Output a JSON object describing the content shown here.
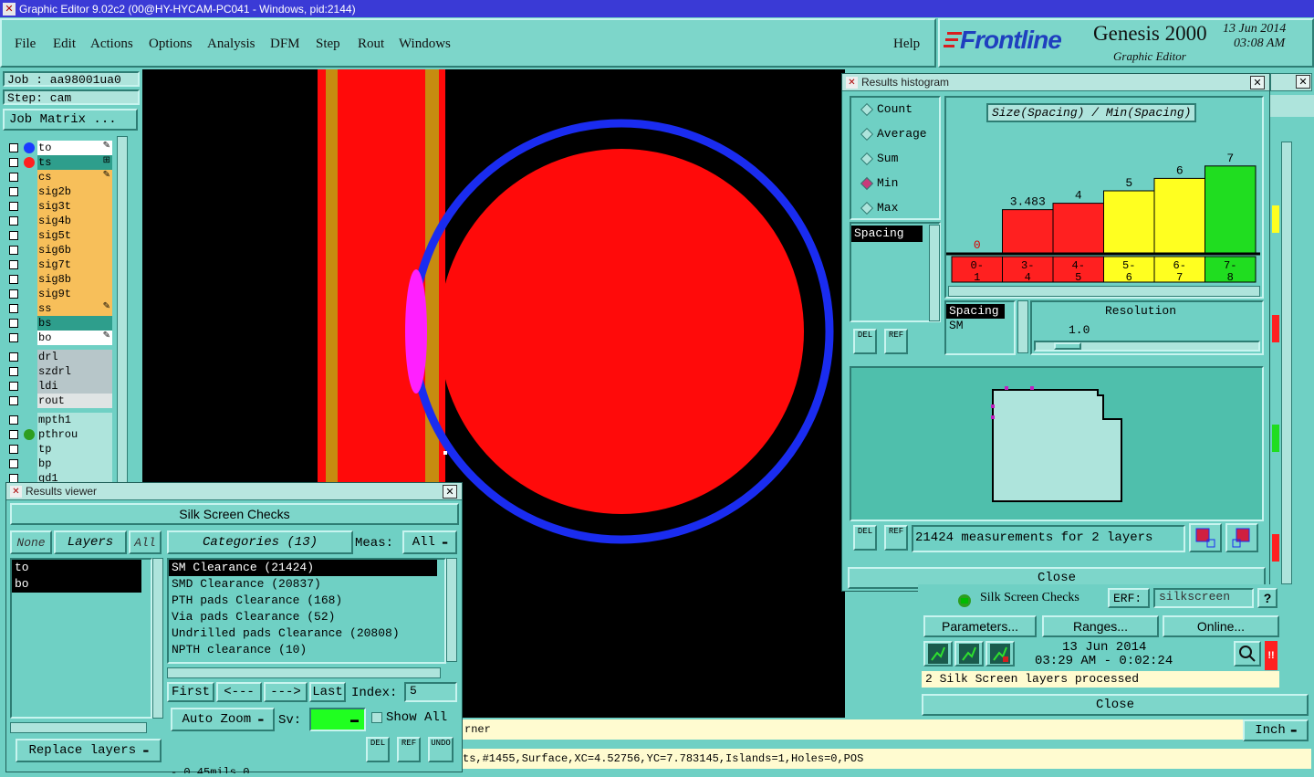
{
  "window_title": "Graphic Editor 9.02c2 (00@HY-HYCAM-PC041 - Windows, pid:2144)",
  "menu": [
    "File",
    "Edit",
    "Actions",
    "Options",
    "Analysis",
    "DFM",
    "Step",
    "Rout",
    "Windows"
  ],
  "help_label": "Help",
  "logo": {
    "brand": "Frontline",
    "product": "Genesis 2000",
    "subtitle": "Graphic Editor",
    "date": "13 Jun 2014",
    "time": "03:08 AM"
  },
  "job": {
    "job_line": "Job : aa98001ua0",
    "step_line": "Step: cam",
    "matrix_button": "Job Matrix ..."
  },
  "layers_signal": [
    {
      "name": "to",
      "color": "#ffffff",
      "dot": "#1a3cff",
      "mark": "✎"
    },
    {
      "name": "ts",
      "color": "#2e9e8c",
      "dot": "#ff2020",
      "mark": "⊞"
    },
    {
      "name": "cs",
      "color": "#f7bf5a",
      "dot": "",
      "mark": "✎"
    },
    {
      "name": "sig2b",
      "color": "#f7bf5a",
      "dot": "",
      "mark": ""
    },
    {
      "name": "sig3t",
      "color": "#f7bf5a",
      "dot": "",
      "mark": ""
    },
    {
      "name": "sig4b",
      "color": "#f7bf5a",
      "dot": "",
      "mark": ""
    },
    {
      "name": "sig5t",
      "color": "#f7bf5a",
      "dot": "",
      "mark": ""
    },
    {
      "name": "sig6b",
      "color": "#f7bf5a",
      "dot": "",
      "mark": ""
    },
    {
      "name": "sig7t",
      "color": "#f7bf5a",
      "dot": "",
      "mark": ""
    },
    {
      "name": "sig8b",
      "color": "#f7bf5a",
      "dot": "",
      "mark": ""
    },
    {
      "name": "sig9t",
      "color": "#f7bf5a",
      "dot": "",
      "mark": ""
    },
    {
      "name": "ss",
      "color": "#f7bf5a",
      "dot": "",
      "mark": "✎"
    },
    {
      "name": "bs",
      "color": "#2e9e8c",
      "dot": "",
      "mark": ""
    },
    {
      "name": "bo",
      "color": "#ffffff",
      "dot": "",
      "mark": "✎"
    }
  ],
  "layers_drill": [
    {
      "name": "drl",
      "color": "#b7c6c9"
    },
    {
      "name": "szdrl",
      "color": "#b7c6c9"
    },
    {
      "name": "ldi",
      "color": "#b7c6c9"
    },
    {
      "name": "rout",
      "color": "#dfe4e4"
    }
  ],
  "layers_misc": [
    {
      "name": "mpth1",
      "color": "#aee4dc",
      "dot": ""
    },
    {
      "name": "pthrou",
      "color": "#aee4dc",
      "dot": "#2e9e20"
    },
    {
      "name": "tp",
      "color": "#aee4dc",
      "dot": ""
    },
    {
      "name": "bp",
      "color": "#aee4dc",
      "dot": ""
    },
    {
      "name": "gd1",
      "color": "#aee4dc",
      "dot": ""
    }
  ],
  "histogram": {
    "title": "Results histogram",
    "radio_options": [
      "Count",
      "Average",
      "Sum",
      "Min",
      "Max"
    ],
    "selected_radio": "Min",
    "measure_item": "Spacing",
    "chart_label": "Size(Spacing) / Min(Spacing)",
    "del_label": "DEL",
    "ref_label": "REF",
    "spacing_label": "Spacing",
    "sm_label": "SM",
    "resolution_label": "Resolution",
    "resolution_value": "1.0",
    "measurements_text": "21424 measurements for 2 layers",
    "close_label": "Close"
  },
  "chart_data": {
    "type": "bar",
    "title": "Size(Spacing) / Min(Spacing)",
    "categories": [
      "0-1",
      "3-4",
      "4-5",
      "5-6",
      "6-7",
      "7-8"
    ],
    "category_lines": [
      [
        "0-",
        "1"
      ],
      [
        "3-",
        "4"
      ],
      [
        "4-",
        "5"
      ],
      [
        "5-",
        "6"
      ],
      [
        "6-",
        "7"
      ],
      [
        "7-",
        "8"
      ]
    ],
    "values": [
      0,
      3.483,
      4,
      5,
      6,
      7
    ],
    "value_labels": [
      "0",
      "3.483",
      "4",
      "5",
      "6",
      "7"
    ],
    "colors": [
      "#ff2020",
      "#ff2020",
      "#ff2020",
      "#ffff20",
      "#ffff20",
      "#20dd20"
    ],
    "ylim": [
      0,
      7.5
    ]
  },
  "results_viewer": {
    "title": "Results viewer",
    "header": "Silk Screen Checks",
    "none_label": "None",
    "layers_label": "Layers",
    "all_label": "All",
    "categories_label": "Categories (13)",
    "meas_label": "Meas:",
    "meas_value": "All",
    "layers": [
      "to",
      "bo"
    ],
    "categories": [
      "SM Clearance (21424)",
      "SMD Clearance (20837)",
      "PTH pads Clearance (168)",
      "Via pads Clearance (52)",
      "Undrilled pads Clearance (20808)",
      "NPTH clearance (10)"
    ],
    "first_label": "First",
    "prev_label": "<---",
    "next_label": "--->",
    "last_label": "Last",
    "index_label": "Index:",
    "index_value": "5",
    "autozoom_label": "Auto Zoom",
    "sv_label": "Sv:",
    "showall_label": "Show All",
    "replace_label": "Replace layers",
    "del_label": "DEL",
    "ref_label": "REF",
    "undo_label": "UNDO",
    "bottom_text": "- 0.45mils 0"
  },
  "silk_panel": {
    "name": "Silk Screen Checks",
    "erf_label": "ERF:",
    "erf_value": "silkscreen",
    "help_q": "?",
    "parameters_label": "Parameters...",
    "ranges_label": "Ranges...",
    "online_label": "Online...",
    "date": "13 Jun 2014",
    "time": "03:29 AM - 0:02:24",
    "status": "2 Silk Screen layers processed",
    "close_label": "Close",
    "alert": "!!"
  },
  "status": {
    "message": "rner",
    "units": "Inch",
    "coords": "ts,#1455,Surface,XC=4.52756,YC=7.783145,Islands=1,Holes=0,POS"
  }
}
